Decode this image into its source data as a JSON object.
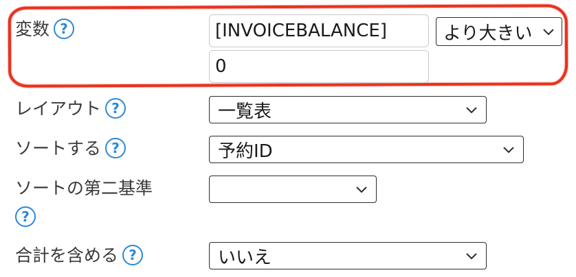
{
  "variable": {
    "label": "変数",
    "help": "?",
    "field_value": "[INVOICEBALANCE]",
    "operator": "より大きい",
    "comparison_value": "0"
  },
  "layout": {
    "label": "レイアウト",
    "help": "?",
    "selected": "一覧表"
  },
  "sort": {
    "label": "ソートする",
    "help": "?",
    "selected": "予約ID"
  },
  "secondary_sort": {
    "label": "ソートの第二基準",
    "help": "?",
    "selected": ""
  },
  "include_total": {
    "label": "合計を含める",
    "help": "?",
    "selected": "いいえ"
  },
  "colors": {
    "highlight": "#e8321e",
    "help_icon": "#2a88d8"
  }
}
